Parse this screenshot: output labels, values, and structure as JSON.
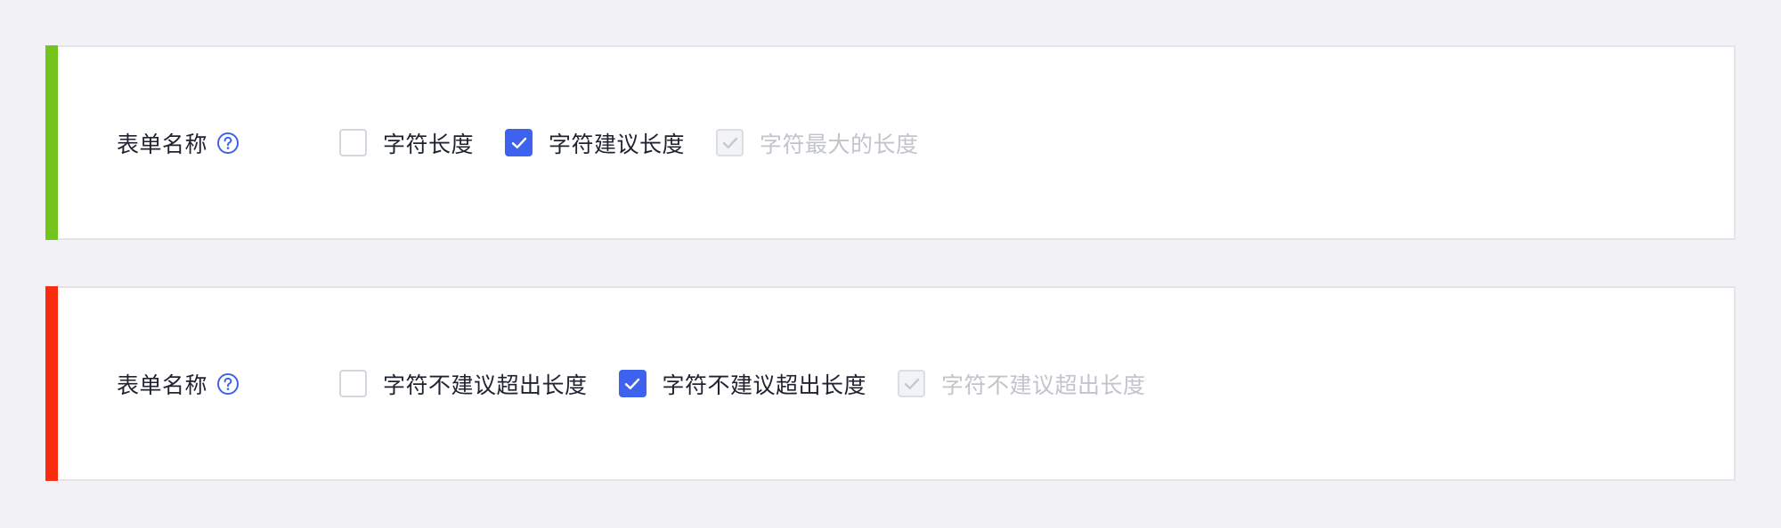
{
  "colors": {
    "success_accent": "#73c41d",
    "error_accent": "#fa2c0f",
    "primary": "#3d63ee",
    "help_icon": "#3d63ee",
    "text": "#1f2230",
    "disabled_text": "#c2c4cc"
  },
  "rows": [
    {
      "status": "success",
      "label": "表单名称",
      "help_icon": "question-circle-icon",
      "options": [
        {
          "label": "字符长度",
          "checked": false,
          "disabled": false
        },
        {
          "label": "字符建议长度",
          "checked": true,
          "disabled": false
        },
        {
          "label": "字符最大的长度",
          "checked": true,
          "disabled": true
        }
      ]
    },
    {
      "status": "error",
      "label": "表单名称",
      "help_icon": "question-circle-icon",
      "options": [
        {
          "label": "字符不建议超出长度",
          "checked": false,
          "disabled": false
        },
        {
          "label": "字符不建议超出长度",
          "checked": true,
          "disabled": false
        },
        {
          "label": "字符不建议超出长度",
          "checked": true,
          "disabled": true
        }
      ]
    }
  ]
}
